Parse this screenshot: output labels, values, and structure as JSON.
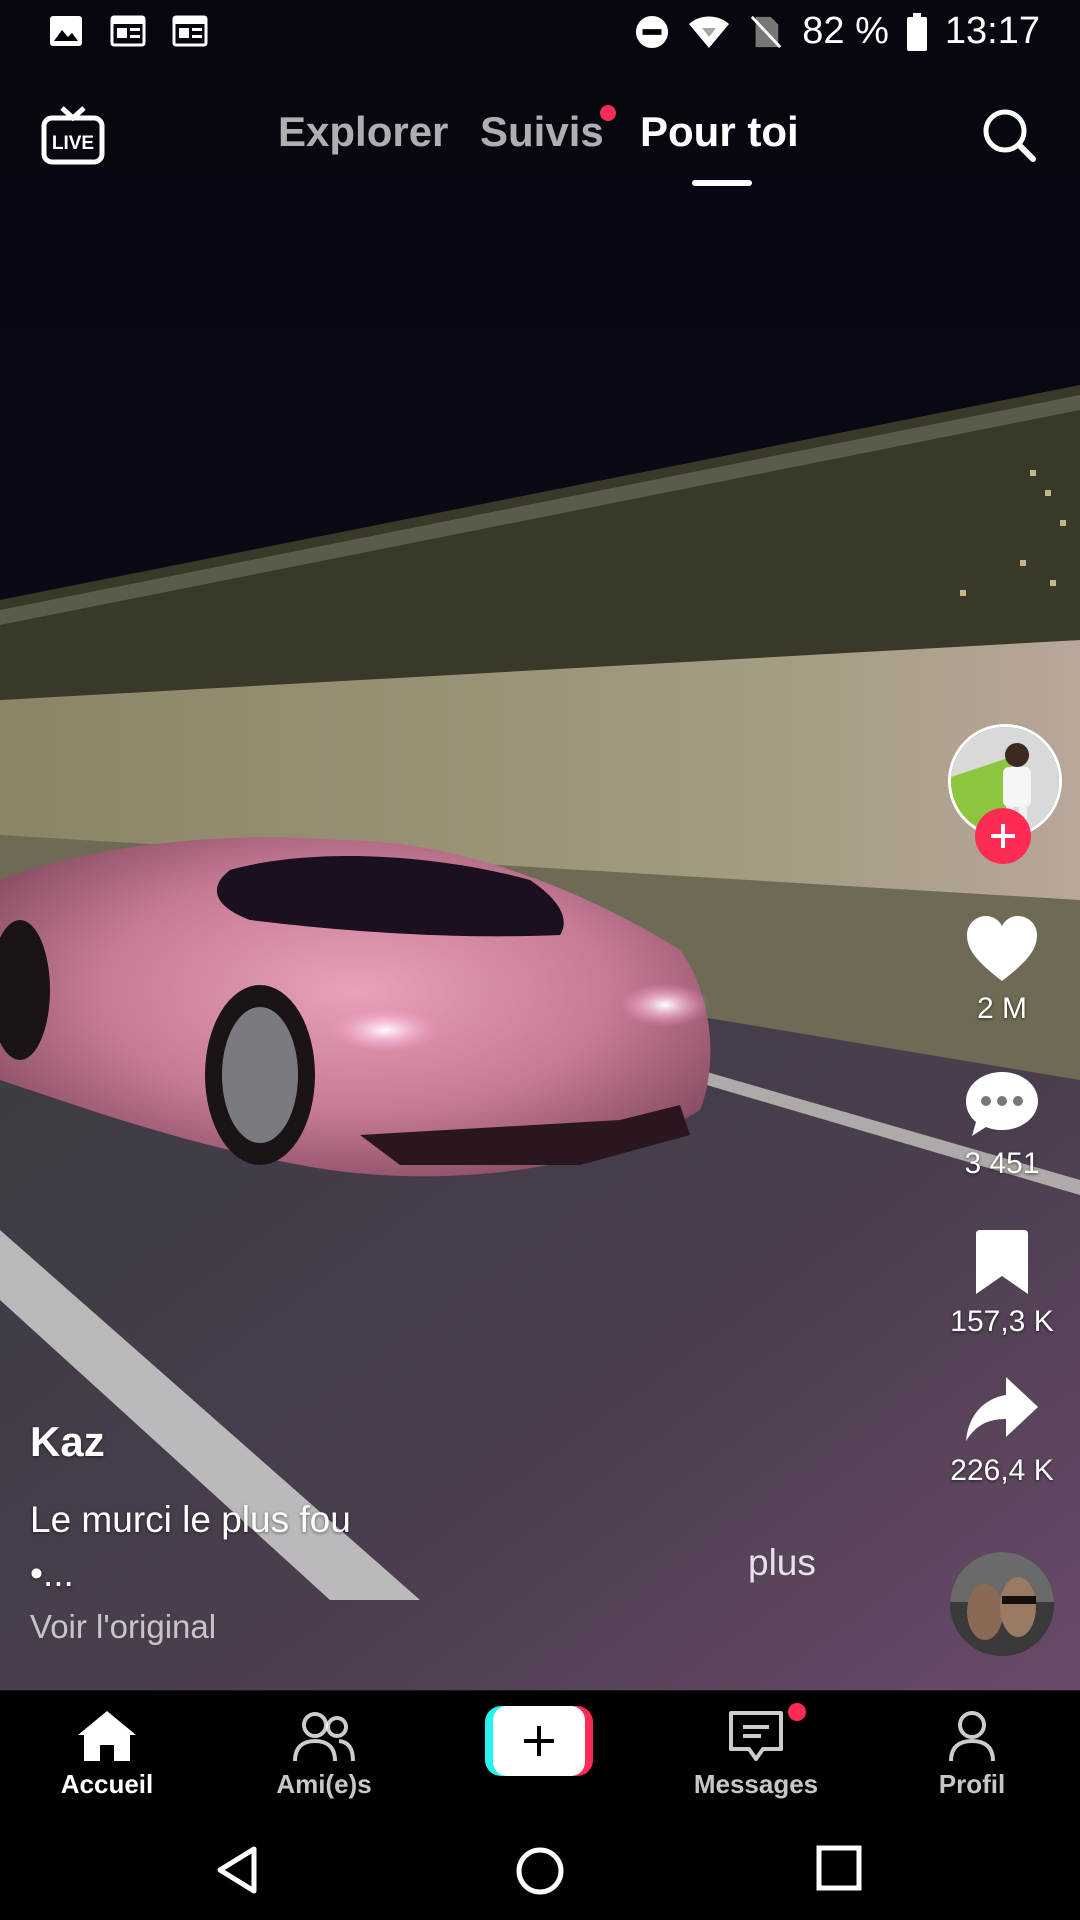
{
  "status_bar": {
    "battery": "82 %",
    "time": "13:17",
    "left_icons": [
      "gallery-icon",
      "news-icon",
      "news-icon"
    ],
    "right_icons": [
      "do-not-disturb-icon",
      "wifi-icon",
      "no-sim-icon",
      "battery-icon"
    ]
  },
  "top_nav": {
    "live_icon": "live-icon",
    "tabs": [
      {
        "label": "Explorer",
        "active": false
      },
      {
        "label": "Suivis",
        "active": false,
        "dot": true
      },
      {
        "label": "Pour toi",
        "active": true
      }
    ],
    "search_icon": "search-icon"
  },
  "actions": {
    "like_count": "2 M",
    "comment_count": "3 451",
    "save_count": "157,3 K",
    "share_count": "226,4 K"
  },
  "post": {
    "username": "Kaz",
    "caption_line1": "Le murci le plus fou",
    "caption_line2": "•...",
    "more_label": "plus",
    "translate_label": "Voir l'original"
  },
  "bottom_bar": {
    "home": "Accueil",
    "friends": "Ami(e)s",
    "messages": "Messages",
    "profile": "Profil"
  },
  "colors": {
    "accent": "#fe2c55",
    "cyan": "#25f4ee"
  }
}
